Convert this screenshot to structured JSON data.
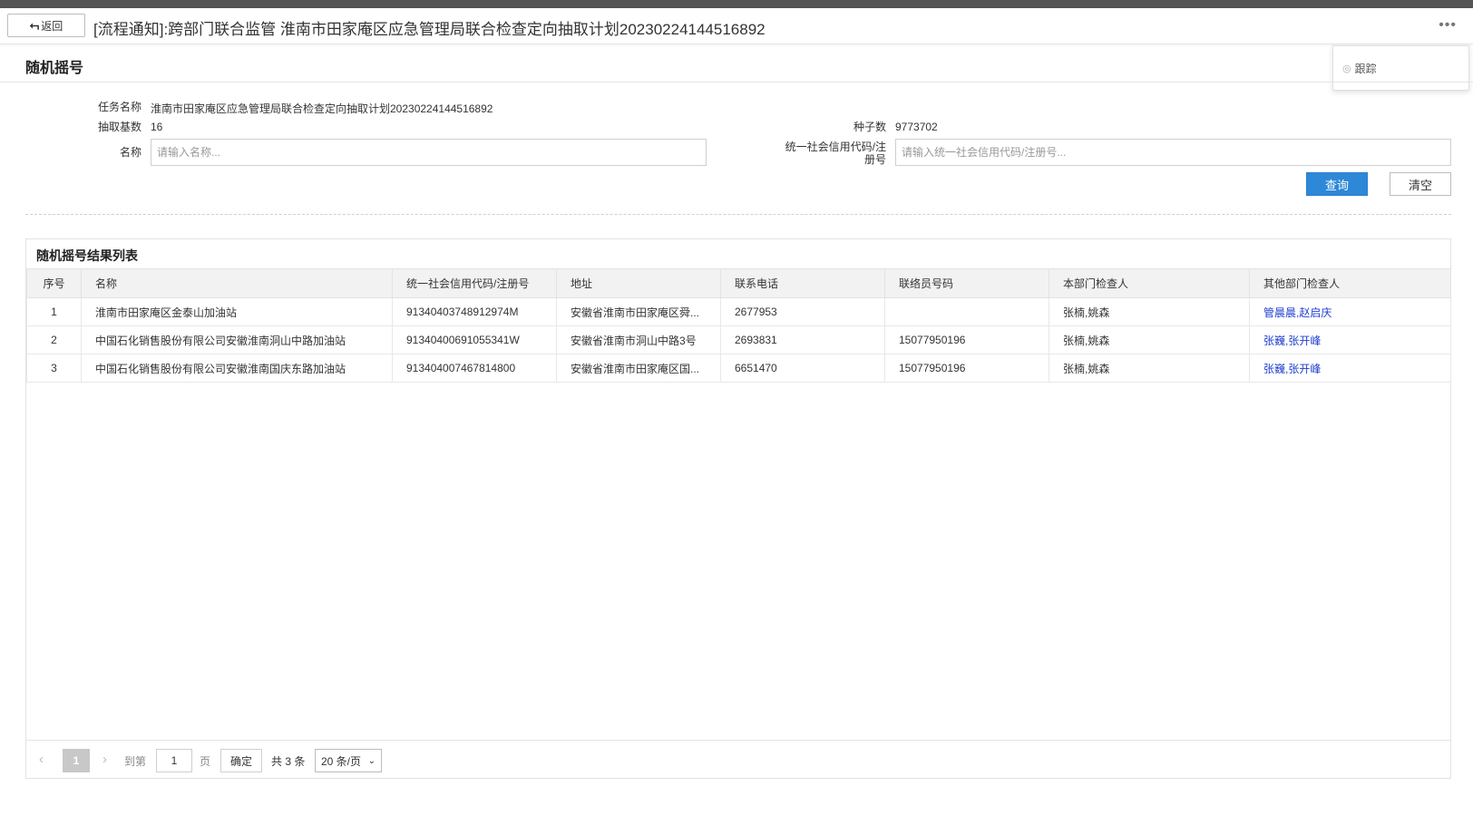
{
  "header": {
    "back_label": "返回",
    "title": "[流程通知]:跨部门联合监管 淮南市田家庵区应急管理局联合检查定向抽取计划20230224144516892",
    "more_label": "•••"
  },
  "popover": {
    "item_label": "跟踪"
  },
  "section": {
    "title": "随机摇号"
  },
  "form": {
    "task_label": "任务名称",
    "task_value": "淮南市田家庵区应急管理局联合检查定向抽取计划20230224144516892",
    "base_label": "抽取基数",
    "base_value": "16",
    "seed_label": "种子数",
    "seed_value": "9773702",
    "name_label": "名称",
    "name_placeholder": "请输入名称...",
    "credit_label": "统一社会信用代码/注册号",
    "credit_placeholder": "请输入统一社会信用代码/注册号...",
    "query_label": "查询",
    "clear_label": "清空"
  },
  "results": {
    "title": "随机摇号结果列表",
    "columns": [
      "序号",
      "名称",
      "统一社会信用代码/注册号",
      "地址",
      "联系电话",
      "联络员号码",
      "本部门检查人",
      "其他部门检查人"
    ],
    "rows": [
      {
        "idx": "1",
        "name": "淮南市田家庵区金泰山加油站",
        "code": "91340403748912974M",
        "address": "安徽省淮南市田家庵区舜...",
        "phone": "2677953",
        "liaison": "",
        "inspectors": "张楠,姚森",
        "other_inspectors": "管晨晨,赵启庆"
      },
      {
        "idx": "2",
        "name": "中国石化销售股份有限公司安徽淮南洞山中路加油站",
        "code": "91340400691055341W",
        "address": "安徽省淮南市洞山中路3号",
        "phone": "2693831",
        "liaison": "15077950196",
        "inspectors": "张楠,姚森",
        "other_inspectors": "张巍,张开峰"
      },
      {
        "idx": "3",
        "name": "中国石化销售股份有限公司安徽淮南国庆东路加油站",
        "code": "913404007467814800",
        "address": "安徽省淮南市田家庵区国...",
        "phone": "6651470",
        "liaison": "15077950196",
        "inspectors": "张楠,姚森",
        "other_inspectors": "张巍,张开峰"
      }
    ]
  },
  "pager": {
    "prev": "‹",
    "current_page": "1",
    "next": "›",
    "goto_label": "到第",
    "goto_value": "1",
    "page_unit": "页",
    "confirm_label": "确定",
    "total_label": "共 3 条",
    "page_size": "20 条/页",
    "chevron": "⌄"
  }
}
